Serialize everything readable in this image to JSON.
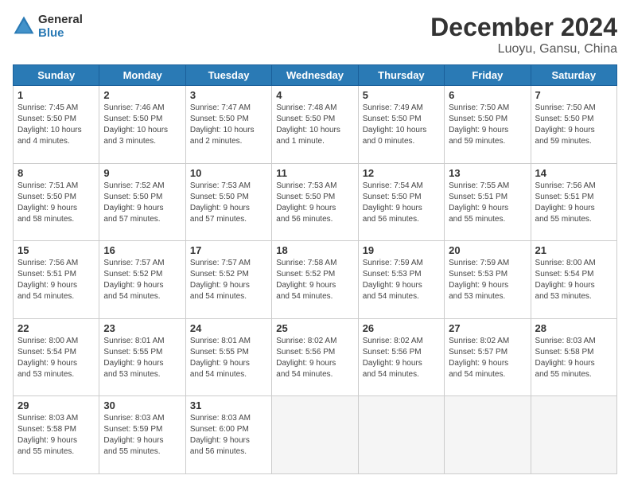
{
  "logo": {
    "text_general": "General",
    "text_blue": "Blue"
  },
  "title": "December 2024",
  "subtitle": "Luoyu, Gansu, China",
  "headers": [
    "Sunday",
    "Monday",
    "Tuesday",
    "Wednesday",
    "Thursday",
    "Friday",
    "Saturday"
  ],
  "days": [
    {
      "num": "",
      "info": ""
    },
    {
      "num": "",
      "info": ""
    },
    {
      "num": "",
      "info": ""
    },
    {
      "num": "",
      "info": ""
    },
    {
      "num": "",
      "info": ""
    },
    {
      "num": "",
      "info": ""
    },
    {
      "num": "1",
      "info": "Sunrise: 7:45 AM\nSunset: 5:50 PM\nDaylight: 10 hours\nand 4 minutes."
    },
    {
      "num": "2",
      "info": "Sunrise: 7:46 AM\nSunset: 5:50 PM\nDaylight: 10 hours\nand 3 minutes."
    },
    {
      "num": "3",
      "info": "Sunrise: 7:47 AM\nSunset: 5:50 PM\nDaylight: 10 hours\nand 2 minutes."
    },
    {
      "num": "4",
      "info": "Sunrise: 7:48 AM\nSunset: 5:50 PM\nDaylight: 10 hours\nand 1 minute."
    },
    {
      "num": "5",
      "info": "Sunrise: 7:49 AM\nSunset: 5:50 PM\nDaylight: 10 hours\nand 0 minutes."
    },
    {
      "num": "6",
      "info": "Sunrise: 7:50 AM\nSunset: 5:50 PM\nDaylight: 9 hours\nand 59 minutes."
    },
    {
      "num": "7",
      "info": "Sunrise: 7:50 AM\nSunset: 5:50 PM\nDaylight: 9 hours\nand 59 minutes."
    },
    {
      "num": "8",
      "info": "Sunrise: 7:51 AM\nSunset: 5:50 PM\nDaylight: 9 hours\nand 58 minutes."
    },
    {
      "num": "9",
      "info": "Sunrise: 7:52 AM\nSunset: 5:50 PM\nDaylight: 9 hours\nand 57 minutes."
    },
    {
      "num": "10",
      "info": "Sunrise: 7:53 AM\nSunset: 5:50 PM\nDaylight: 9 hours\nand 57 minutes."
    },
    {
      "num": "11",
      "info": "Sunrise: 7:53 AM\nSunset: 5:50 PM\nDaylight: 9 hours\nand 56 minutes."
    },
    {
      "num": "12",
      "info": "Sunrise: 7:54 AM\nSunset: 5:50 PM\nDaylight: 9 hours\nand 56 minutes."
    },
    {
      "num": "13",
      "info": "Sunrise: 7:55 AM\nSunset: 5:51 PM\nDaylight: 9 hours\nand 55 minutes."
    },
    {
      "num": "14",
      "info": "Sunrise: 7:56 AM\nSunset: 5:51 PM\nDaylight: 9 hours\nand 55 minutes."
    },
    {
      "num": "15",
      "info": "Sunrise: 7:56 AM\nSunset: 5:51 PM\nDaylight: 9 hours\nand 54 minutes."
    },
    {
      "num": "16",
      "info": "Sunrise: 7:57 AM\nSunset: 5:52 PM\nDaylight: 9 hours\nand 54 minutes."
    },
    {
      "num": "17",
      "info": "Sunrise: 7:57 AM\nSunset: 5:52 PM\nDaylight: 9 hours\nand 54 minutes."
    },
    {
      "num": "18",
      "info": "Sunrise: 7:58 AM\nSunset: 5:52 PM\nDaylight: 9 hours\nand 54 minutes."
    },
    {
      "num": "19",
      "info": "Sunrise: 7:59 AM\nSunset: 5:53 PM\nDaylight: 9 hours\nand 54 minutes."
    },
    {
      "num": "20",
      "info": "Sunrise: 7:59 AM\nSunset: 5:53 PM\nDaylight: 9 hours\nand 53 minutes."
    },
    {
      "num": "21",
      "info": "Sunrise: 8:00 AM\nSunset: 5:54 PM\nDaylight: 9 hours\nand 53 minutes."
    },
    {
      "num": "22",
      "info": "Sunrise: 8:00 AM\nSunset: 5:54 PM\nDaylight: 9 hours\nand 53 minutes."
    },
    {
      "num": "23",
      "info": "Sunrise: 8:01 AM\nSunset: 5:55 PM\nDaylight: 9 hours\nand 53 minutes."
    },
    {
      "num": "24",
      "info": "Sunrise: 8:01 AM\nSunset: 5:55 PM\nDaylight: 9 hours\nand 54 minutes."
    },
    {
      "num": "25",
      "info": "Sunrise: 8:02 AM\nSunset: 5:56 PM\nDaylight: 9 hours\nand 54 minutes."
    },
    {
      "num": "26",
      "info": "Sunrise: 8:02 AM\nSunset: 5:56 PM\nDaylight: 9 hours\nand 54 minutes."
    },
    {
      "num": "27",
      "info": "Sunrise: 8:02 AM\nSunset: 5:57 PM\nDaylight: 9 hours\nand 54 minutes."
    },
    {
      "num": "28",
      "info": "Sunrise: 8:03 AM\nSunset: 5:58 PM\nDaylight: 9 hours\nand 55 minutes."
    },
    {
      "num": "29",
      "info": "Sunrise: 8:03 AM\nSunset: 5:58 PM\nDaylight: 9 hours\nand 55 minutes."
    },
    {
      "num": "30",
      "info": "Sunrise: 8:03 AM\nSunset: 5:59 PM\nDaylight: 9 hours\nand 55 minutes."
    },
    {
      "num": "31",
      "info": "Sunrise: 8:03 AM\nSunset: 6:00 PM\nDaylight: 9 hours\nand 56 minutes."
    },
    {
      "num": "",
      "info": ""
    },
    {
      "num": "",
      "info": ""
    },
    {
      "num": "",
      "info": ""
    },
    {
      "num": "",
      "info": ""
    }
  ]
}
